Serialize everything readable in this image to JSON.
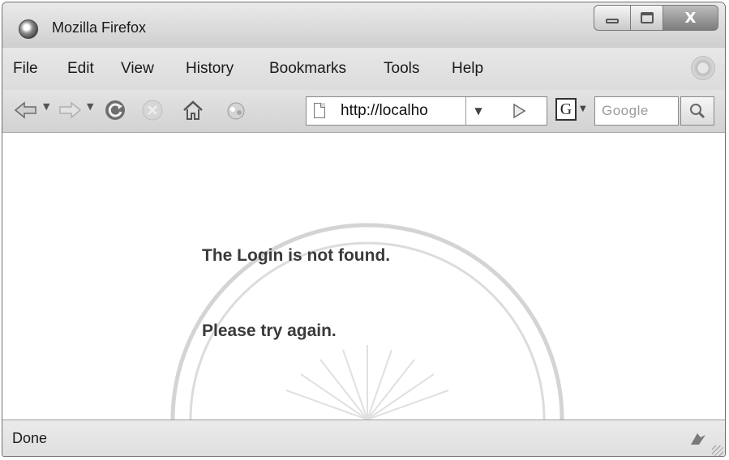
{
  "window": {
    "title": "Mozilla Firefox",
    "controls": {
      "minimize": "minimize",
      "maximize": "maximize",
      "close": "X"
    }
  },
  "menubar": {
    "items": [
      {
        "label": "File"
      },
      {
        "label": "Edit"
      },
      {
        "label": "View"
      },
      {
        "label": "History"
      },
      {
        "label": "Bookmarks"
      },
      {
        "label": "Tools"
      },
      {
        "label": "Help"
      }
    ]
  },
  "toolbar": {
    "icons": [
      "back-icon",
      "forward-icon",
      "reload-icon",
      "stop-icon",
      "home-icon",
      "bookmark-icon"
    ],
    "url": "http://localho",
    "search_engine_letter": "G",
    "search_placeholder": "Google"
  },
  "content": {
    "message_line1": "The Login is not found.",
    "message_line2": "Please try again."
  },
  "statusbar": {
    "text": "Done"
  },
  "colors": {
    "chrome_bg": "#d8d8d8",
    "content_bg": "#ffffff",
    "message_text": "#3a3a3a"
  }
}
